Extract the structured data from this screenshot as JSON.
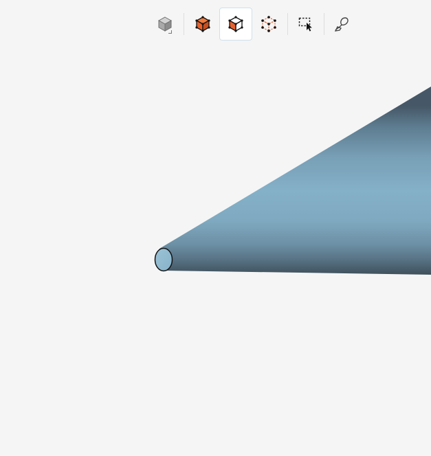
{
  "toolbar": {
    "tools": [
      {
        "id": "shaded-view",
        "icon": "shaded-cube-icon",
        "active": false,
        "has_dropdown": true
      },
      {
        "id": "select-body",
        "icon": "orange-cube-icon",
        "active": false
      },
      {
        "id": "select-face",
        "icon": "cube-face-select-icon",
        "active": true
      },
      {
        "id": "select-vertex",
        "icon": "cube-vertex-select-icon",
        "active": false
      },
      {
        "id": "box-select",
        "icon": "box-select-icon",
        "active": false
      },
      {
        "id": "lasso-select",
        "icon": "lasso-select-icon",
        "active": false
      }
    ]
  },
  "colors": {
    "background": "#f5f5f5",
    "model_light": "#84b0c8",
    "model_dark": "#4a5d6c",
    "accent_orange": "#e8612c",
    "outline": "#111111"
  },
  "scene": {
    "object": "cone"
  }
}
